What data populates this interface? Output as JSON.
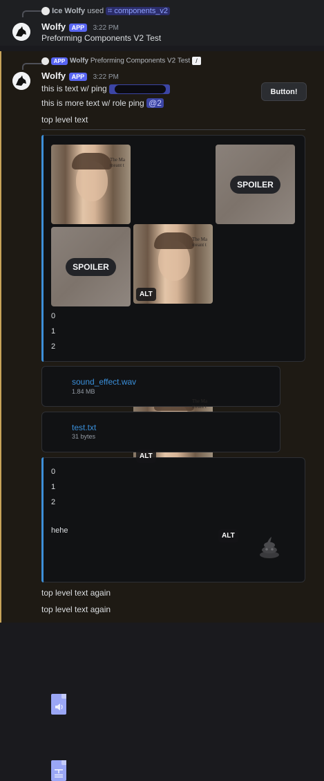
{
  "reply1": {
    "user": "Ice Wolfy",
    "used": "used",
    "command": "components_v2"
  },
  "msg1": {
    "author": "Wolfy",
    "badge": "APP",
    "time": "3:22 PM",
    "text": "Preforming Components V2 Test"
  },
  "reply2": {
    "badge": "APP",
    "author": "Wolfy",
    "text": "Preforming Components V2 Test"
  },
  "msg2": {
    "author": "Wolfy",
    "badge": "APP",
    "time": "3:22 PM",
    "line1": "this is text  w/ ping",
    "line2": "this is more text  w/ role ping",
    "role_ping": "@2",
    "line3": "top level text",
    "button_label": "Button!"
  },
  "gallery": {
    "spoiler_label": "SPOILER",
    "alt_label": "ALT",
    "caption_line1": "The Ma",
    "caption_line2": "meant t",
    "list": [
      "0",
      "1",
      "2"
    ]
  },
  "files": [
    {
      "name": "sound_effect.wav",
      "size": "1.84 MB",
      "icon": "audio-file-icon"
    },
    {
      "name": "test.txt",
      "size": "31 bytes",
      "icon": "text-file-icon"
    }
  ],
  "container2": {
    "list": [
      "0",
      "1",
      "2"
    ],
    "footer": "hehe",
    "thumbnail_icon": "poop-emoji-icon"
  },
  "bottom": {
    "line1": "top level text again",
    "line2": "top level text again"
  },
  "colors": {
    "accent_blue": "#3d8fd8",
    "app_badge": "#5865f2",
    "link": "#3a8fda",
    "highlight_border": "#c7a45a"
  }
}
